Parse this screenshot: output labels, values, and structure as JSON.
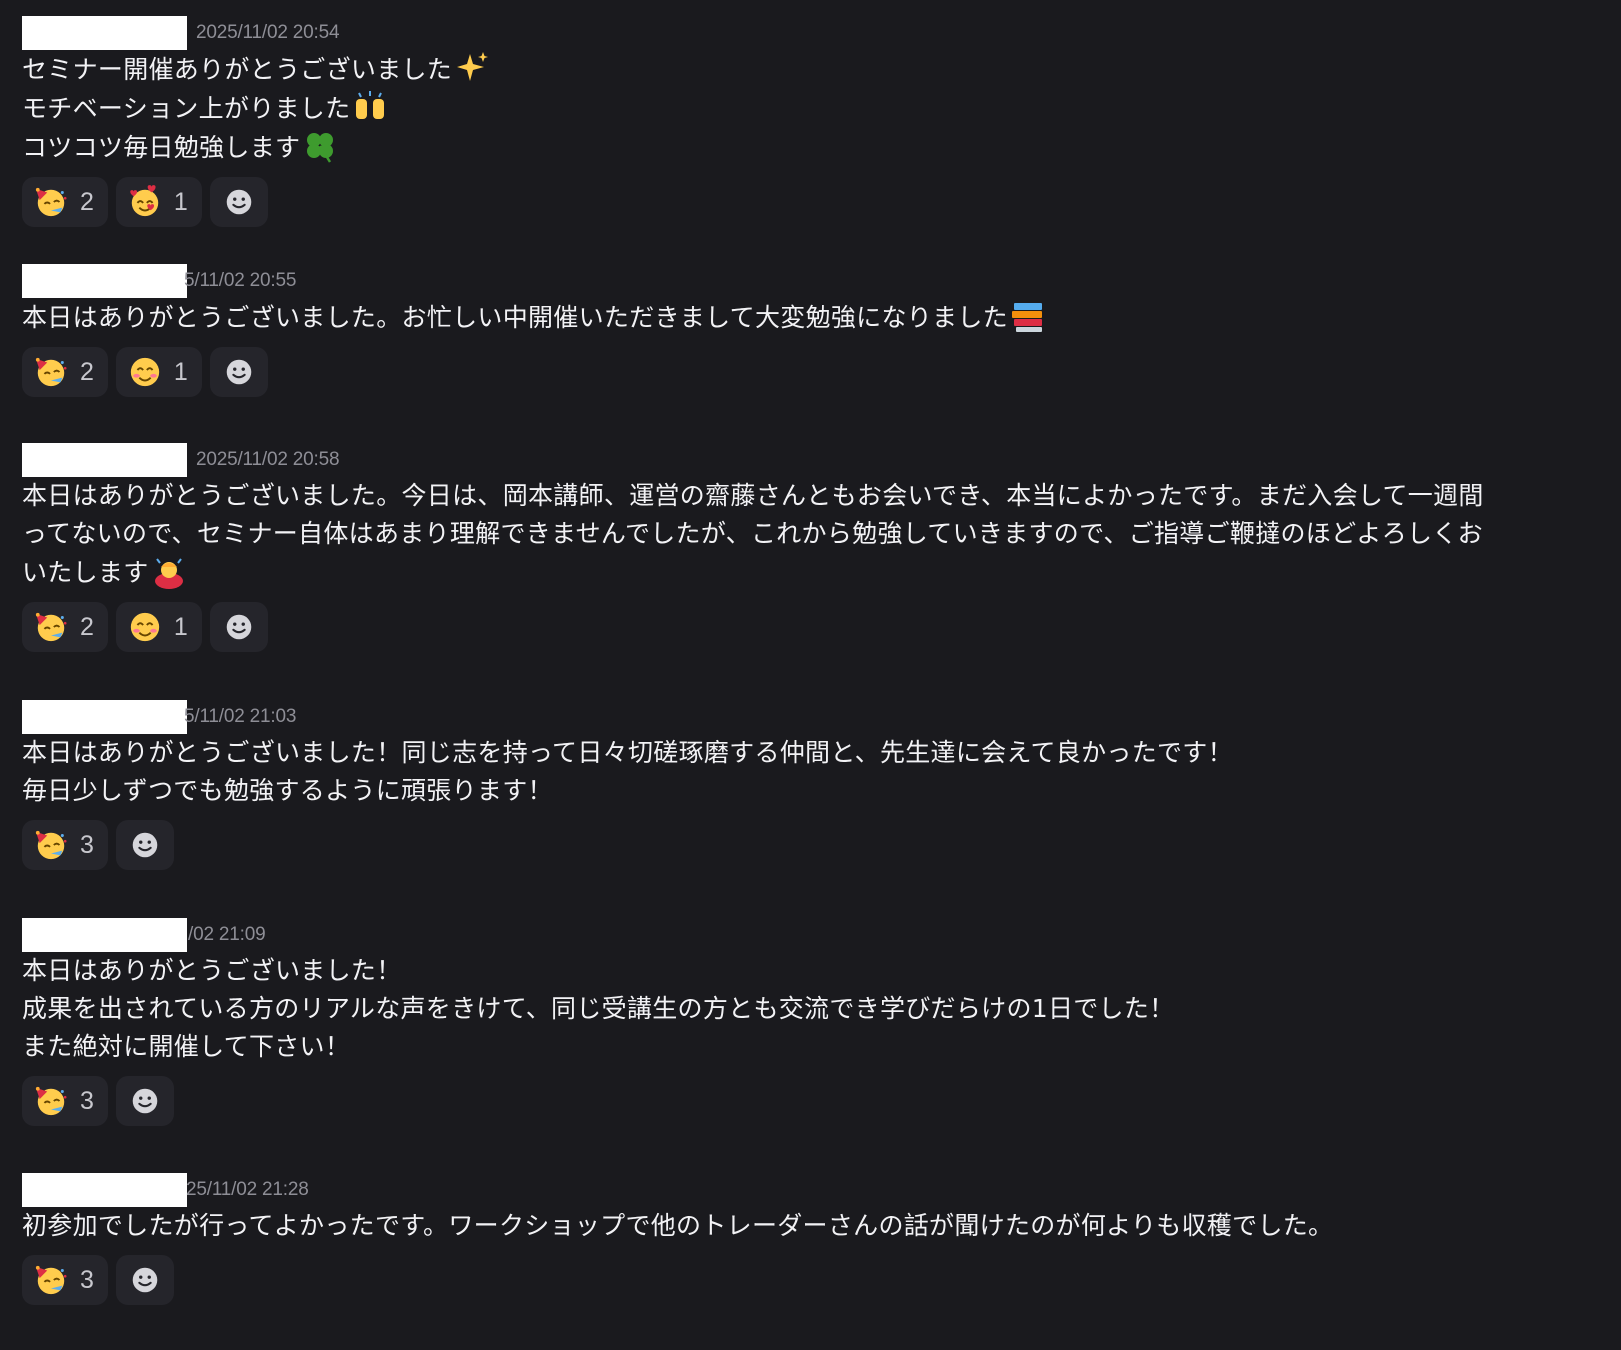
{
  "messages": [
    {
      "timestamp": "2025/11/02 20:54",
      "lines": [
        "セミナー開催ありがとうございました",
        "モチベーション上がりました",
        "コツコツ毎日勉強します"
      ],
      "line_emojis": [
        "sparkles-icon",
        "raised-hands-icon",
        "four-leaf-clover-icon"
      ],
      "reactions": [
        {
          "emoji": "partying-face-icon",
          "count": "2"
        },
        {
          "emoji": "smiling-face-with-hearts-icon",
          "count": "1"
        }
      ]
    },
    {
      "timestamp": "5/11/02 20:55",
      "lines": [
        "本日はありがとうございました。お忙しい中開催いただきまして大変勉強になりました"
      ],
      "line_emojis": [
        "books-icon"
      ],
      "reactions": [
        {
          "emoji": "partying-face-icon",
          "count": "2"
        },
        {
          "emoji": "smiling-face-with-smiling-eyes-icon",
          "count": "1"
        }
      ]
    },
    {
      "timestamp": "2025/11/02 20:58",
      "lines": [
        "本日はありがとうございました。今日は、岡本講師、運営の齋藤さんともお会いでき、本当によかったです。まだ入会して一週間",
        "ってないので、セミナー自体はあまり理解できませんでしたが、これから勉強していきますので、ご指導ご鞭撻のほどよろしくお",
        "いたします"
      ],
      "line_emojis": [
        "",
        "",
        "person-bowing-icon"
      ],
      "reactions": [
        {
          "emoji": "partying-face-icon",
          "count": "2"
        },
        {
          "emoji": "smiling-face-with-smiling-eyes-icon",
          "count": "1"
        }
      ]
    },
    {
      "timestamp": "5/11/02 21:03",
      "lines": [
        "本日はありがとうございました！同じ志を持って日々切磋琢磨する仲間と、先生達に会えて良かったです！",
        "毎日少しずつでも勉強するように頑張ります！"
      ],
      "line_emojis": [
        "",
        ""
      ],
      "reactions": [
        {
          "emoji": "partying-face-icon",
          "count": "3"
        }
      ]
    },
    {
      "timestamp": "/02 21:09",
      "lines": [
        "本日はありがとうございました！",
        "成果を出されている方のリアルな声をきけて、同じ受講生の方とも交流でき学びだらけの1日でした！",
        "また絶対に開催して下さい！"
      ],
      "line_emojis": [
        "",
        "",
        ""
      ],
      "reactions": [
        {
          "emoji": "partying-face-icon",
          "count": "3"
        }
      ]
    },
    {
      "timestamp": "25/11/02 21:28",
      "lines": [
        "初参加でしたが行ってよかったです。ワークショップで他のトレーダーさんの話が聞けたのが何よりも収穫でした。"
      ],
      "line_emojis": [
        ""
      ],
      "reactions": [
        {
          "emoji": "partying-face-icon",
          "count": "3"
        }
      ]
    }
  ],
  "add_reaction_icon": "add-reaction-smiley-icon"
}
